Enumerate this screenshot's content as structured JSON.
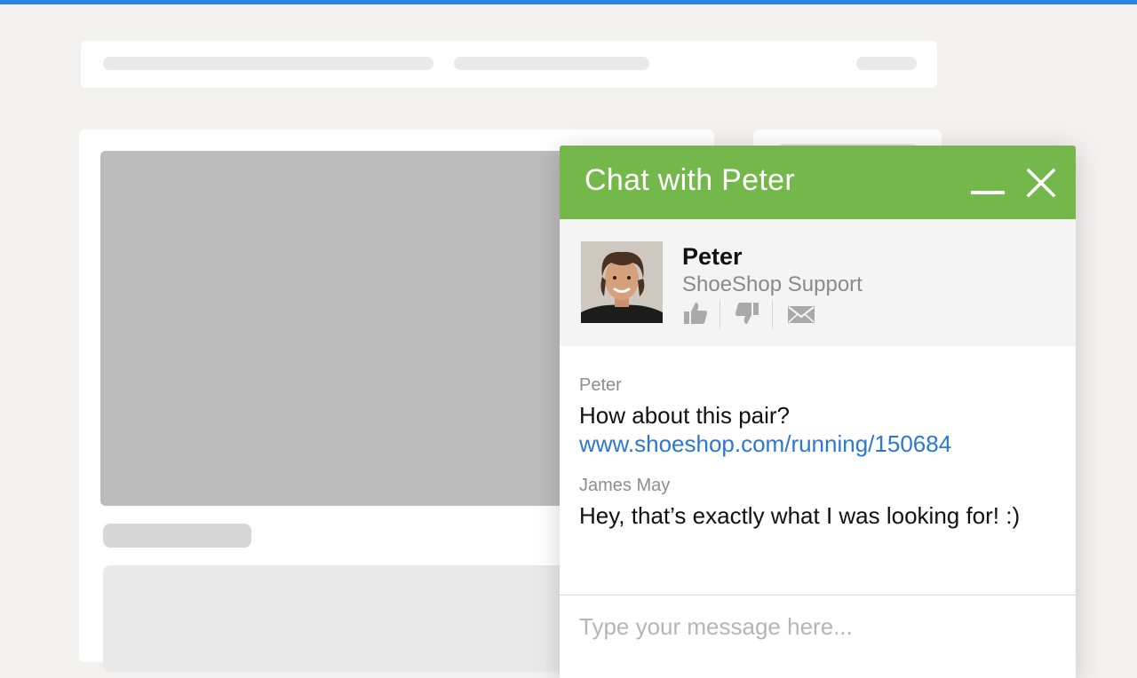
{
  "colors": {
    "accent_bar": "#2a86dd",
    "chat_header": "#74b84b",
    "link": "#2a78d4"
  },
  "chat": {
    "title": "Chat with Peter",
    "minimize_icon": "minimize-icon",
    "close_icon": "close-icon",
    "agent": {
      "name": "Peter",
      "role": "ShoeShop Support",
      "actions": [
        "thumbs-up-icon",
        "thumbs-down-icon",
        "mail-icon"
      ]
    },
    "messages": [
      {
        "author": "Peter",
        "text": "How about this pair?",
        "link": "www.shoeshop.com/running/150684"
      },
      {
        "author": "James May",
        "text": "Hey, that’s exactly what I was looking for! :)"
      }
    ],
    "composer": {
      "placeholder": "Type your message here...",
      "value": ""
    }
  }
}
